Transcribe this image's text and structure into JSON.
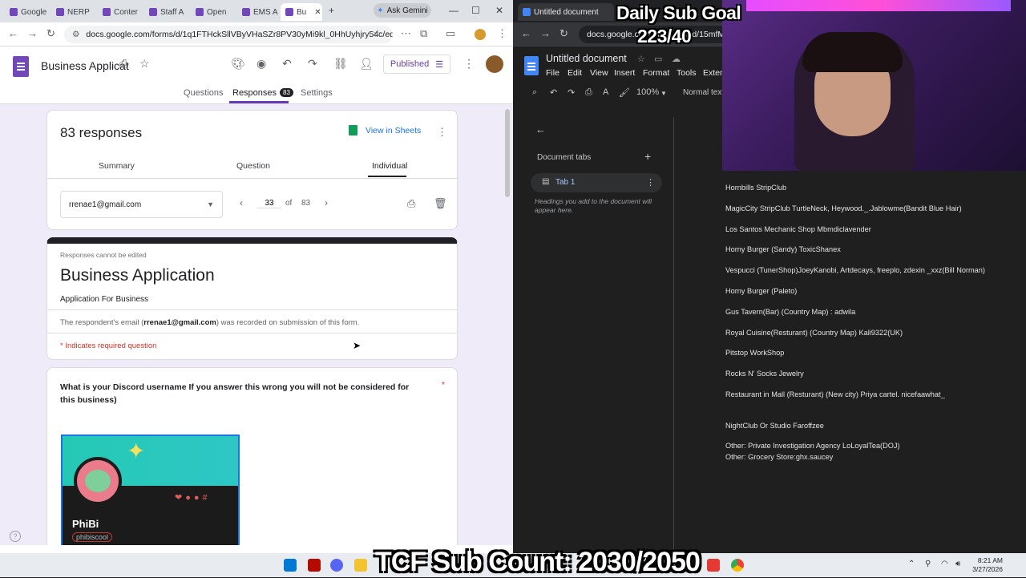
{
  "left_browser": {
    "tabs": [
      {
        "label": "Google"
      },
      {
        "label": "NERP"
      },
      {
        "label": "Conter"
      },
      {
        "label": "Staff A"
      },
      {
        "label": "Open"
      },
      {
        "label": "EMS A"
      },
      {
        "label": "Bu"
      }
    ],
    "ask_gemini": "Ask Gemini",
    "url": "docs.google.com/forms/d/1q1FTHckSllVByVHaSZr8PV30yMi9kl_0HhUyhjry54c/edit..."
  },
  "forms": {
    "title": "Business Applicat",
    "published_label": "Published",
    "tabs": {
      "questions": "Questions",
      "responses": "Responses",
      "responses_count": "83",
      "settings": "Settings"
    },
    "responses_header": "83 responses",
    "view_in_sheets": "View in Sheets",
    "subtabs": {
      "summary": "Summary",
      "question": "Question",
      "individual": "Individual"
    },
    "respondent_email": "rrenae1@gmail.com",
    "pager": {
      "current": "33",
      "of": "of",
      "total": "83"
    },
    "cannot_edit": "Responses cannot be edited",
    "form_title": "Business Application",
    "form_description": "Application For Business",
    "email_note_prefix": "The respondent's email (",
    "email_note_email": "rrenae1@gmail.com",
    "email_note_suffix": ") was recorded on submission of this form.",
    "required_note": "* Indicates required question",
    "question_text": "What is your Discord username  If you answer this wrong you will not be considered for this business)",
    "required_star": "*",
    "discord_card": {
      "name": "PhiBi",
      "username": "phibiscool"
    }
  },
  "right_browser": {
    "tab_label": "Untitled document",
    "url": "docs.google.com/document/d/15mfM",
    "doc_title": "Untitled document",
    "menus": [
      "File",
      "Edit",
      "View",
      "Insert",
      "Format",
      "Tools",
      "Exten"
    ],
    "zoom": "100%",
    "style": "Normal text",
    "document_tabs": "Document tabs",
    "tab1": "Tab 1",
    "headings_hint": "Headings you add to the document will appear here.",
    "lines": [
      "Hornbills StripClub",
      "MagicCity StripClub TurtleNeck, Heywood._.Jablowme(Bandit Blue Hair)",
      "Los Santos Mechanic Shop Mbmdiclavender",
      "Horny Burger (Sandy) ToxicShanex",
      "Vespucci (TunerShop)JoeyKanobi, Artdecays, freeplo, zdexin _xxz(Bill Norman)",
      "Horny Burger (Paleto)",
      "Gus Tavern(Bar) (Country Map) : adwila",
      "Royal Cuisine(Resturant) (Country Map) Kali9322(UK)",
      "Pitstop WorkShop",
      "Rocks N' Socks Jewelry",
      "Restaurant in Mall (Resturant) (New city) Priya cartel. nicefaawhat_",
      "NightClub Or Studio Faroffzee",
      "Other: Private Investigation Agency LoLoyalTea(DOJ)",
      "Other: Grocery Store:ghx.saucey"
    ]
  },
  "overlay": {
    "goal_title": "Daily Sub Goal",
    "goal_count": "223/40",
    "sub_count": "TCF Sub Count: 2030/2050"
  },
  "taskbar": {
    "time": "8:21 AM",
    "date": "3/27/2026"
  },
  "colors": {
    "forms_purple": "#673ab7",
    "docs_dark": "#1f1f1f",
    "required_red": "#d93025"
  }
}
